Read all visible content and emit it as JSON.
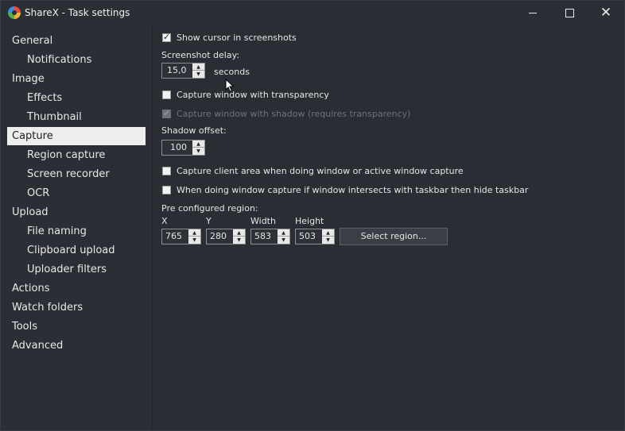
{
  "window": {
    "title": "ShareX - Task settings"
  },
  "sidebar": {
    "items": [
      {
        "label": "General",
        "level": "top"
      },
      {
        "label": "Notifications",
        "level": "sub"
      },
      {
        "label": "Image",
        "level": "top"
      },
      {
        "label": "Effects",
        "level": "sub"
      },
      {
        "label": "Thumbnail",
        "level": "sub"
      },
      {
        "label": "Capture",
        "level": "top",
        "selected": true
      },
      {
        "label": "Region capture",
        "level": "sub"
      },
      {
        "label": "Screen recorder",
        "level": "sub"
      },
      {
        "label": "OCR",
        "level": "sub"
      },
      {
        "label": "Upload",
        "level": "top"
      },
      {
        "label": "File naming",
        "level": "sub"
      },
      {
        "label": "Clipboard upload",
        "level": "sub"
      },
      {
        "label": "Uploader filters",
        "level": "sub"
      },
      {
        "label": "Actions",
        "level": "top"
      },
      {
        "label": "Watch folders",
        "level": "top"
      },
      {
        "label": "Tools",
        "level": "top"
      },
      {
        "label": "Advanced",
        "level": "top"
      }
    ]
  },
  "capture": {
    "show_cursor": {
      "label": "Show cursor in screenshots",
      "checked": true
    },
    "screenshot_delay": {
      "label": "Screenshot delay:",
      "value": "15,0",
      "unit": "seconds"
    },
    "window_transparency": {
      "label": "Capture window with transparency",
      "checked": false
    },
    "window_shadow": {
      "label": "Capture window with shadow (requires transparency)",
      "checked": true,
      "disabled": true
    },
    "shadow_offset": {
      "label": "Shadow offset:",
      "value": "100"
    },
    "client_area": {
      "label": "Capture client area when doing window or active window capture",
      "checked": false
    },
    "hide_taskbar": {
      "label": "When doing window capture if window intersects with taskbar then hide taskbar",
      "checked": false
    },
    "region": {
      "label": "Pre configured region:",
      "x_label": "X",
      "x_value": "765",
      "y_label": "Y",
      "y_value": "280",
      "width_label": "Width",
      "width_value": "583",
      "height_label": "Height",
      "height_value": "503",
      "select_button": "Select region..."
    }
  },
  "icons": {
    "app": "sharex-logo-icon",
    "minimize": "minimize-icon",
    "maximize": "maximize-icon",
    "close": "close-icon",
    "spin_up": "chevron-up-icon",
    "spin_down": "chevron-down-icon",
    "check": "checkmark-icon",
    "cursor": "mouse-pointer-icon"
  },
  "colors": {
    "background": "#2a2d33",
    "sidebar_selected_bg": "#eeeeee",
    "text": "#e6e6e6",
    "disabled_text": "#6f7278"
  }
}
